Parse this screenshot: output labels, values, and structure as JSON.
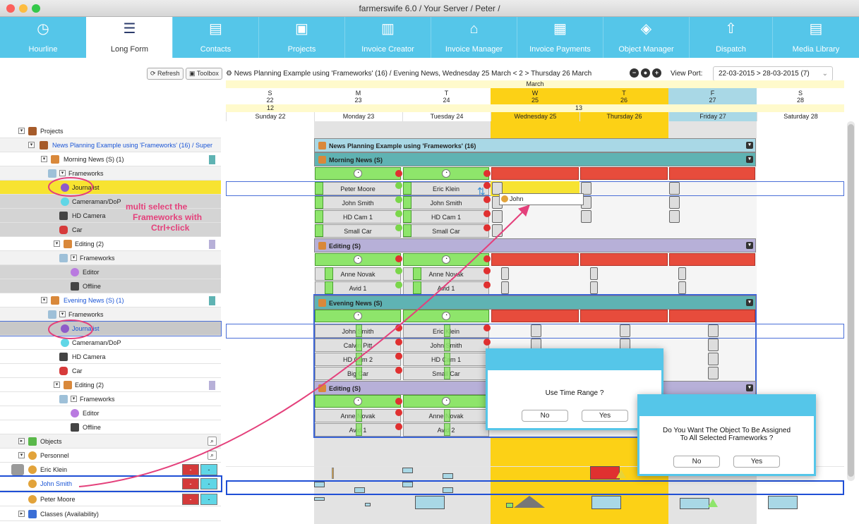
{
  "window": {
    "title": "farmerswife 6.0 / Your Server / Peter /"
  },
  "toolbar": {
    "items": [
      "Hourline",
      "Long Form",
      "Contacts",
      "Projects",
      "Invoice Creator",
      "Invoice Manager",
      "Invoice Payments",
      "Object Manager",
      "Dispatch",
      "Media Library"
    ],
    "active": "Long Form"
  },
  "subtoolbar": {
    "refresh": "Refresh",
    "toolbox": "Toolbox",
    "breadcrumb": "News Planning Example using 'Frameworks' (16) /  Evening News,  Wednesday 25 March < 2 > Thursday 26 March",
    "viewport_label": "View Port:",
    "viewport_value": "22-03-2015 > 28-03-2015 (7)"
  },
  "calendar": {
    "month": "March",
    "week_a": "12",
    "week_b": "13",
    "days": [
      {
        "letter": "S",
        "num": "22",
        "name": "Sunday 22"
      },
      {
        "letter": "M",
        "num": "23",
        "name": "Monday 23"
      },
      {
        "letter": "T",
        "num": "24",
        "name": "Tuesday 24"
      },
      {
        "letter": "W",
        "num": "25",
        "name": "Wednesday 25"
      },
      {
        "letter": "T",
        "num": "26",
        "name": "Thursday 26"
      },
      {
        "letter": "F",
        "num": "27",
        "name": "Friday 27"
      },
      {
        "letter": "S",
        "num": "28",
        "name": "Saturday 28"
      }
    ]
  },
  "tree": {
    "projects": "Projects",
    "project": "News Planning Example using 'Frameworks' (16) / Super",
    "morning": "Morning News (S) (1)",
    "frameworks": "Frameworks",
    "journalist": "Journalist",
    "cameraman": "Cameraman/DoP",
    "hd_camera": "HD Camera",
    "car": "Car",
    "editing": "Editing (2)",
    "editor": "Editor",
    "offline": "Offline",
    "evening": "Evening News (S) (1)",
    "objects": "Objects",
    "personnel": "Personnel",
    "eric": "Eric Klein",
    "john": "John Smith",
    "peter": "Peter Moore",
    "classes": "Classes (Availability)",
    "minus": "-"
  },
  "grid": {
    "project_header": "News Planning Example using 'Frameworks' (16)",
    "morning_header": "Morning News (S)",
    "editing_header": "Editing (S)",
    "evening_header": "Evening News (S)",
    "mon": {
      "peter": "Peter Moore",
      "john": "John Smith",
      "hdcam": "HD Cam 1",
      "car": "Small Car",
      "anne": "Anne Novak",
      "avid": "Avid 1"
    },
    "tue": {
      "eric": "Eric Klein",
      "john": "John Smith",
      "hdcam": "HD Cam 1",
      "car": "Small Car",
      "anne": "Anne Novak",
      "avid": "Avid 1"
    },
    "eve_mon": {
      "john": "John Smith",
      "calvin": "Calvin Pitt",
      "hdcam": "HD Cam 2",
      "car": "Big Car",
      "anne": "Anne Novak",
      "avid": "Avid 1"
    },
    "eve_tue": {
      "eric": "Eric Klein",
      "john": "John Smith",
      "hdcam": "HD Cam 1",
      "car": "Small Car",
      "anne": "Anne Novak",
      "avid": "Avid 2"
    },
    "drag_label": "John"
  },
  "annotation": "multi select the\nFrameworks with\nCtrl+click",
  "dialog1": {
    "message": "Use Time Range ?",
    "no": "No",
    "yes": "Yes"
  },
  "dialog2": {
    "message": "Do You Want The Object To Be Assigned To All Selected Frameworks ?",
    "no": "No",
    "yes": "Yes"
  },
  "colors": {
    "toolbar": "#55c6e9",
    "highlight_yellow": "#f7e331",
    "today": "#fcd116",
    "friday": "#a9d8e6",
    "framework_green": "#8ee56b",
    "framework_red": "#e74c3c",
    "morning_header": "#5fb3b3",
    "editing_header": "#b7b0d8",
    "annotation": "#e4407b"
  }
}
